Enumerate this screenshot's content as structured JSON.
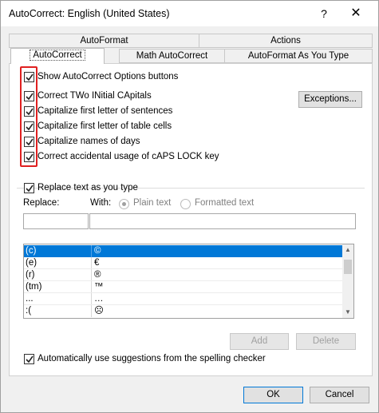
{
  "window": {
    "title": "AutoCorrect: English (United States)",
    "help_label": "?",
    "close_label": "✕"
  },
  "tabs": {
    "row1": [
      "AutoFormat",
      "Actions"
    ],
    "row2": [
      "AutoCorrect",
      "Math AutoCorrect",
      "AutoFormat As You Type"
    ],
    "selected": "AutoCorrect"
  },
  "options": [
    {
      "label": "Show AutoCorrect Options buttons",
      "checked": true
    },
    {
      "label": "Correct TWo INitial CApitals",
      "checked": true
    },
    {
      "label": "Capitalize first letter of sentences",
      "checked": true
    },
    {
      "label": "Capitalize first letter of table cells",
      "checked": true
    },
    {
      "label": "Capitalize names of days",
      "checked": true
    },
    {
      "label": "Correct accidental usage of cAPS LOCK key",
      "checked": true
    }
  ],
  "exceptions_button": "Exceptions...",
  "replace_section": {
    "checkbox_label": "Replace text as you type",
    "checked": true,
    "replace_label": "Replace:",
    "with_label": "With:",
    "plain_text_label": "Plain text",
    "formatted_text_label": "Formatted text",
    "replace_value": "",
    "with_value": ""
  },
  "entries": [
    {
      "replace": "(c)",
      "with": "©",
      "selected": true
    },
    {
      "replace": "(e)",
      "with": "€",
      "selected": false
    },
    {
      "replace": "(r)",
      "with": "®",
      "selected": false
    },
    {
      "replace": "(tm)",
      "with": "™",
      "selected": false
    },
    {
      "replace": "...",
      "with": "…",
      "selected": false
    },
    {
      "replace": ":(",
      "with": "☹",
      "selected": false
    }
  ],
  "add_button": "Add",
  "delete_button": "Delete",
  "suggestions": {
    "label": "Automatically use suggestions from the spelling checker",
    "checked": true
  },
  "ok_button": "OK",
  "cancel_button": "Cancel",
  "colors": {
    "selection": "#0078d7",
    "highlight": "#e02020"
  }
}
